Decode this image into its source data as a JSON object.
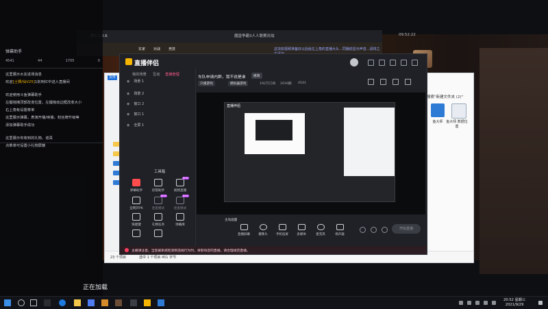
{
  "left_panel": {
    "title": "弹幕助手",
    "stats": [
      "4541",
      "44",
      "1705",
      "0"
    ],
    "messages": [
      {
        "pre": "这里展示水友进场消息",
        "hl": "",
        "post": ""
      },
      {
        "pre": "欢迎",
        "hl": "[士狮/仙V25]",
        "post": "1剑到红中进入直播间"
      },
      {
        "gap": true
      },
      {
        "pre": "欢迎使用斗鱼弹幕助手",
        "hl": "",
        "post": ""
      },
      {
        "pre": "左键拖拽顶部改变位置，左键拖动边框改变大小",
        "hl": "",
        "post": ""
      },
      {
        "pre": "右上角有设置菜单",
        "hl": "",
        "post": ""
      },
      {
        "pre": "这里展示弹幕，表演开播/续播，粉丝牌升级等",
        "hl": "",
        "post": ""
      },
      {
        "pre": "添加弹幕助手成功",
        "hl": "",
        "post": ""
      },
      {
        "gap": true
      },
      {
        "pre": "这里展示你收到的礼物、道具",
        "hl": "",
        "post": ""
      },
      {
        "pre": "点菜单可设置小礼物屏蔽",
        "hl": "",
        "post": ""
      }
    ],
    "loading": "正在加载"
  },
  "back_window": {
    "title": "剑3 1.0.6",
    "mid": "魔兽争霸3人人联赛对战",
    "clock": "09:52:22",
    "pills": [
      "东家",
      "对战",
      "竞技"
    ],
    "notice": "这块如视频准备好以后给左上角的直播大头...同播前显示声音...请将之中添加"
  },
  "explorer": {
    "path": "搜索\"新建文件夹 (2)\"",
    "icons": [
      {
        "label": "鱼大师",
        "color": "#2e7bd6"
      },
      {
        "label": "鱼大师 数据位置",
        "color": "#e8ecf2"
      }
    ],
    "status": [
      "23 个项目",
      "选中 1 个项目 451 字节"
    ],
    "tab": "文件"
  },
  "app": {
    "logo": "直播伴侣",
    "tabs": [
      "我的场景",
      "互动",
      "直播管理"
    ],
    "active_tab": 2,
    "scenes": [
      "场景 1",
      "场景 2",
      "窗口 2",
      "窗口 1",
      "全屏 1"
    ],
    "tools_title": "工具箱",
    "tools": [
      {
        "label": "弹幕助手",
        "red": true,
        "new": false,
        "dim": false
      },
      {
        "label": "房管助手",
        "red": false,
        "new": false,
        "dim": false
      },
      {
        "label": "视频直播",
        "red": false,
        "new": true,
        "dim": false
      },
      {
        "label": "全网开PK",
        "red": false,
        "new": false,
        "dim": false
      },
      {
        "label": "连麦模式",
        "red": false,
        "new": true,
        "dim": true
      },
      {
        "label": "连麦模式",
        "red": false,
        "new": true,
        "dim": true
      },
      {
        "label": "快捷键",
        "red": false,
        "new": false,
        "dim": false
      },
      {
        "label": "礼物任务",
        "red": false,
        "new": false,
        "dim": false
      },
      {
        "label": "弹幕库",
        "red": false,
        "new": false,
        "dim": false
      },
      {
        "label": "",
        "red": false,
        "new": false,
        "dim": false
      },
      {
        "label": "",
        "red": false,
        "new": false,
        "dim": false
      }
    ],
    "stream": {
      "title": "车队申请内群，我不说是谁",
      "edit": "修改",
      "chips": [
        "只播游戏",
        "模拟器游戏"
      ],
      "meta": [
        "192万订阅",
        "2016期",
        "4541"
      ]
    },
    "preview_logo": "直播伴侣",
    "bottom_label": "主动画面",
    "bottom_items": [
      "直播屏幕",
      "摄像头",
      "手机投屏",
      "多媒体",
      "麦克风",
      "扬声器"
    ],
    "start_button": "开始直播",
    "warning": "主播请注意，当您被系统检测到违规行为时，将影响您的直播，请合理规范直播。"
  },
  "taskbar": {
    "time": "20:52 星期三",
    "date": "2021/9/29"
  }
}
